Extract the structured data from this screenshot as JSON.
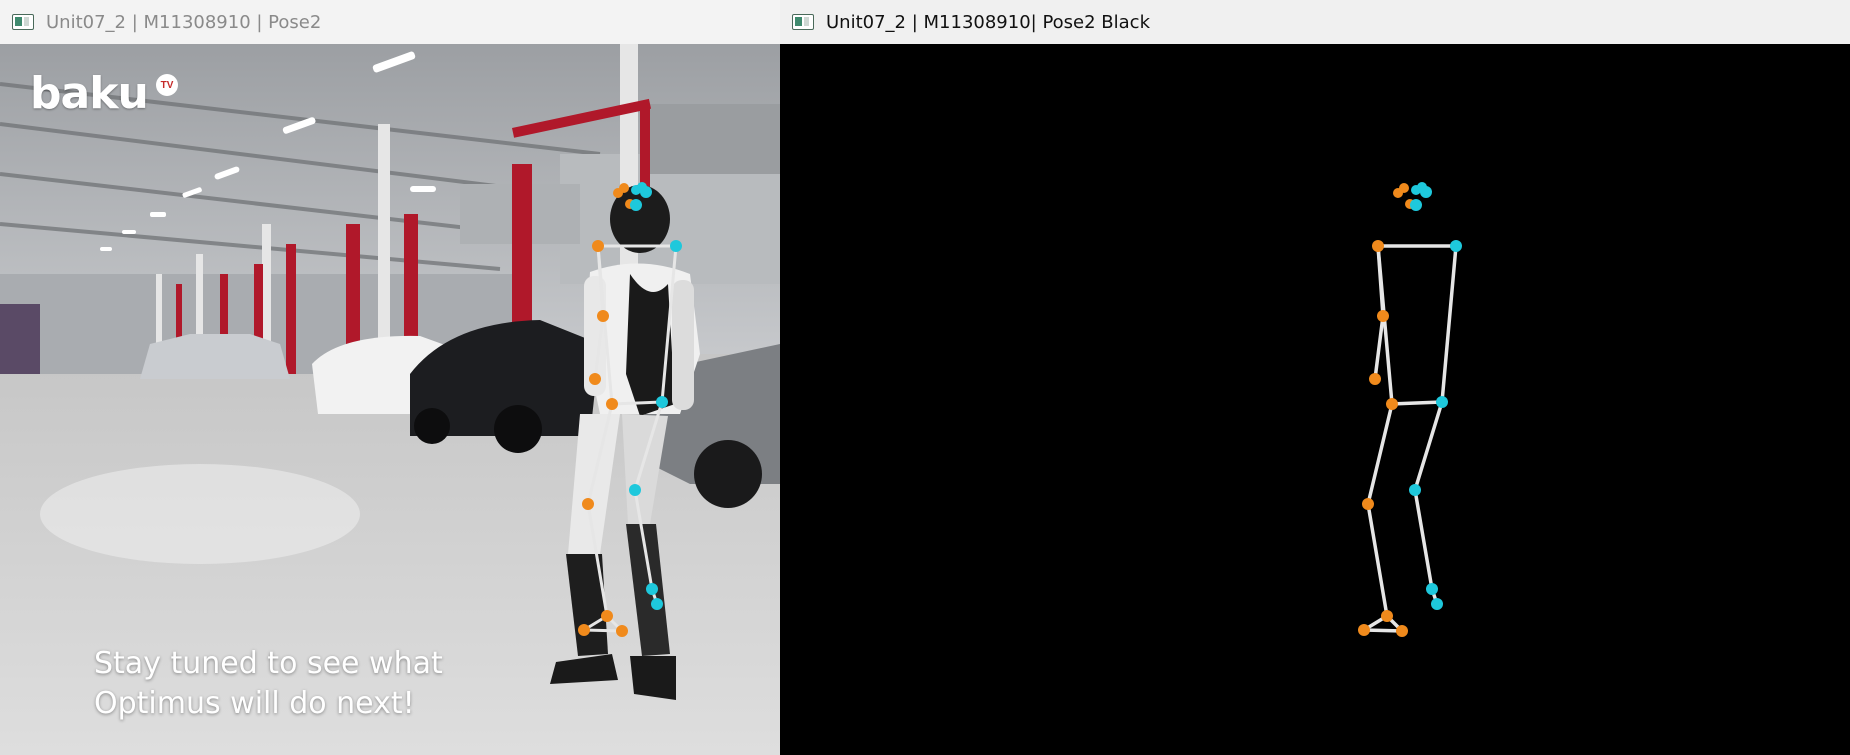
{
  "left_window": {
    "title": "Unit07_2 | M11308910 | Pose2",
    "watermark": "baku",
    "watermark_badge": "TV",
    "caption_line1": "Stay tuned to see what",
    "caption_line2": "Optimus will do next!"
  },
  "right_window": {
    "title": "Unit07_2 | M11308910| Pose2 Black"
  },
  "colors": {
    "left_side_joint": "#f08a1c",
    "right_side_joint": "#1ec8dc",
    "bone": "#e6e6e6",
    "overlay_bg": "#000000"
  },
  "icons": [
    "app-window-icon"
  ]
}
